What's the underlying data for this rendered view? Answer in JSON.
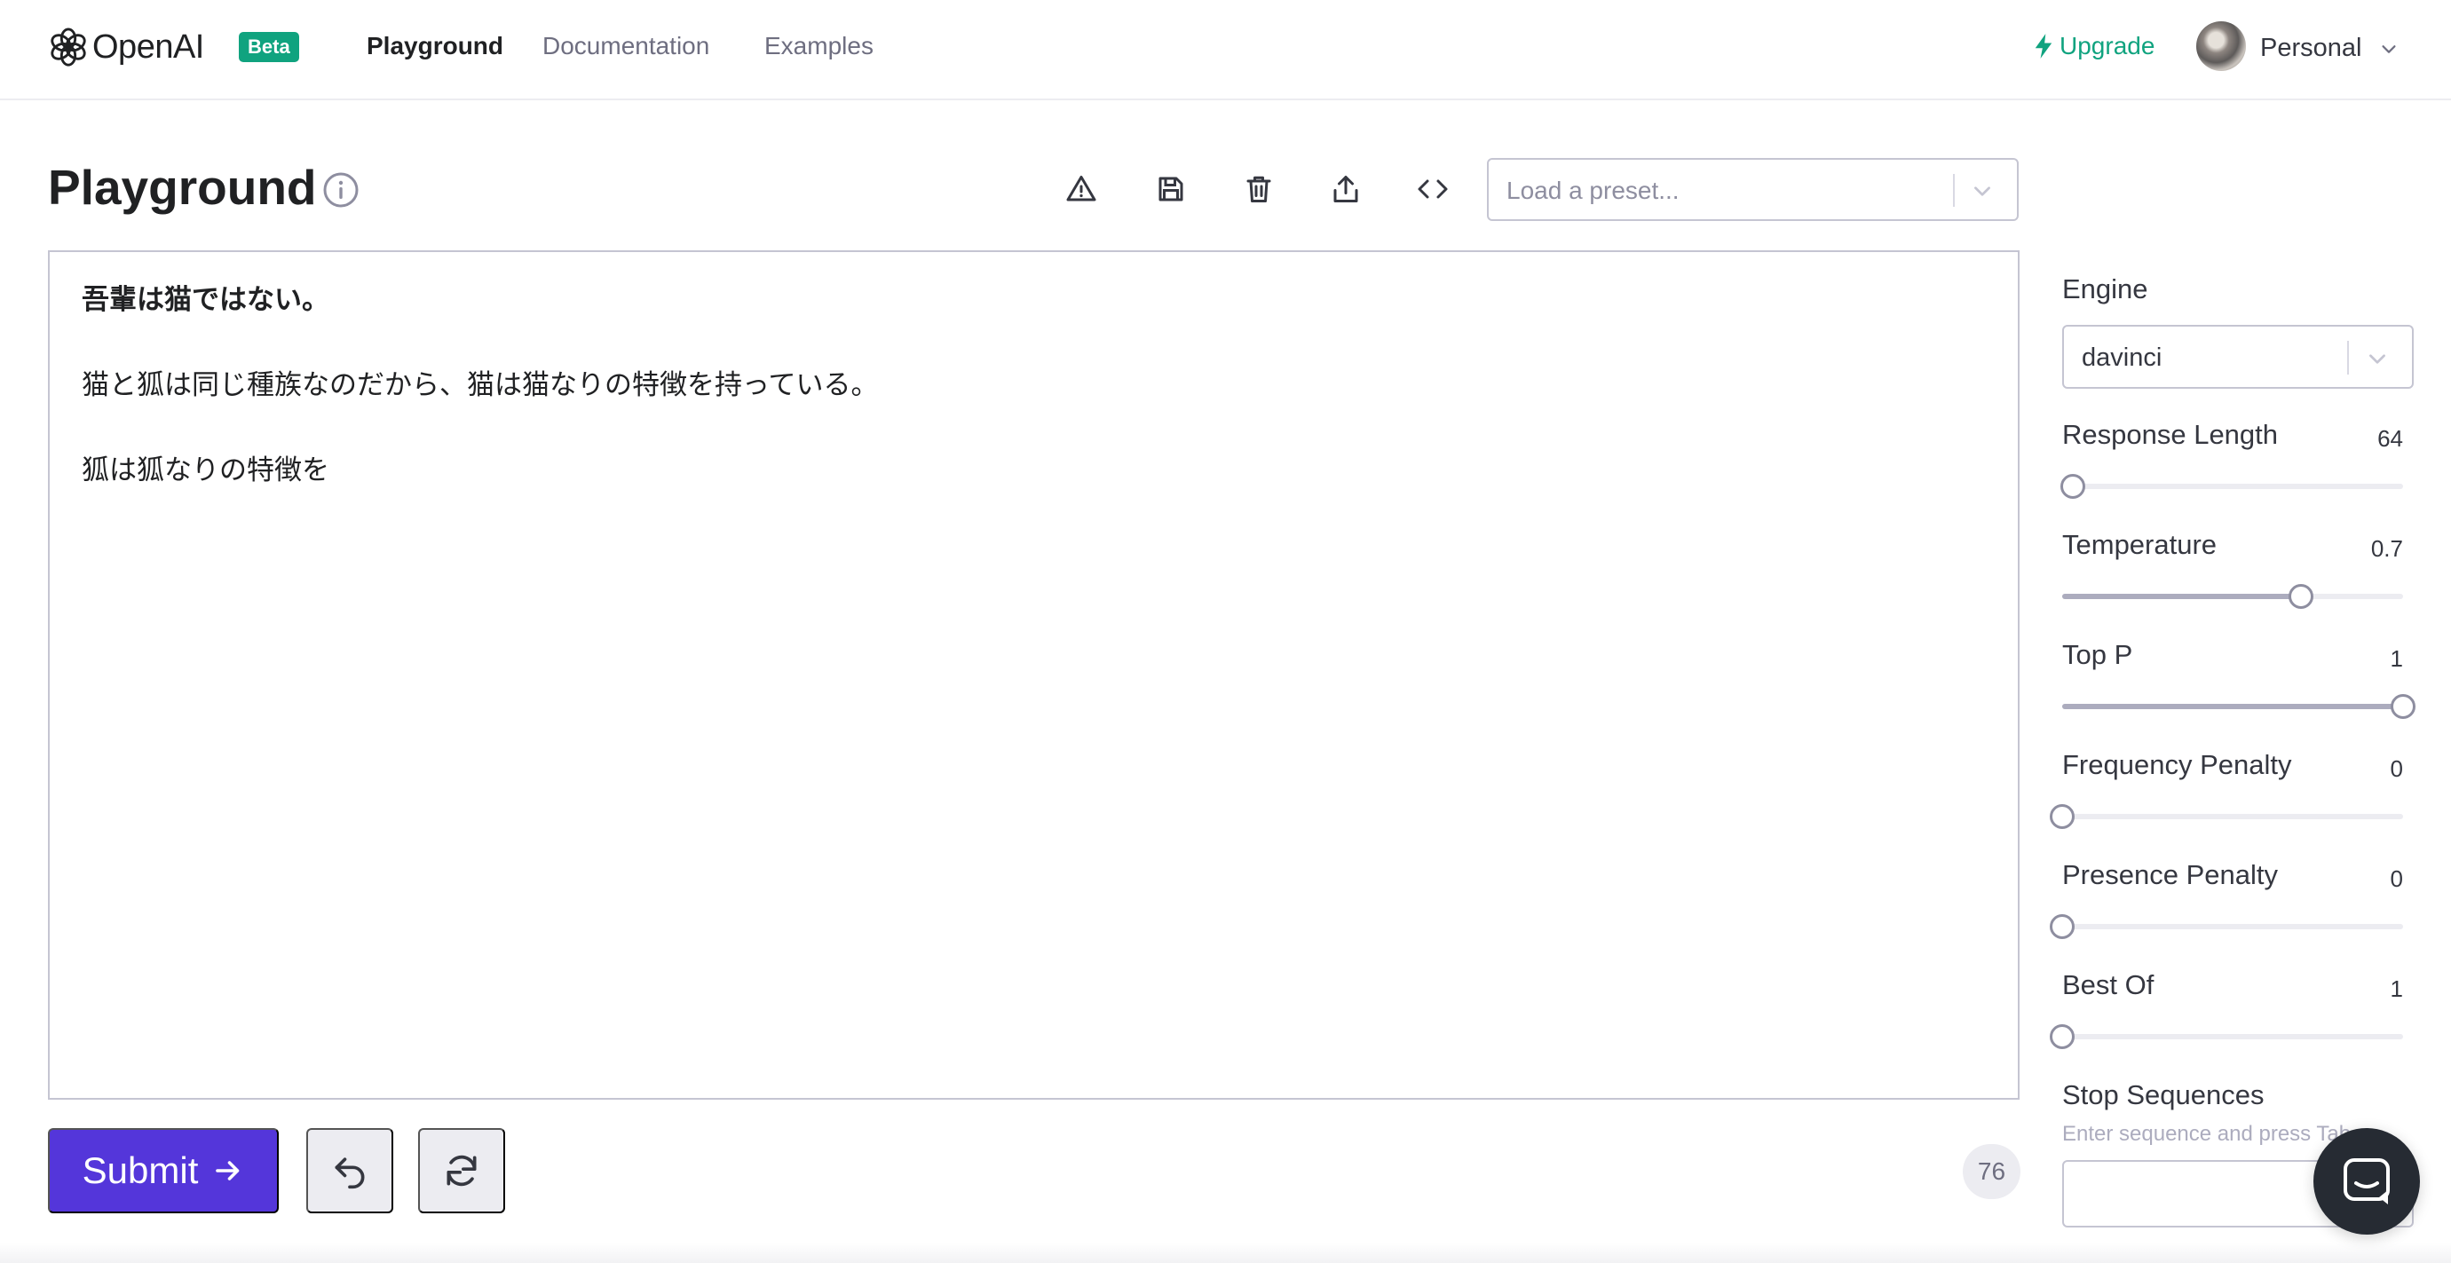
{
  "brand": {
    "name": "OpenAI",
    "badge": "Beta"
  },
  "nav": {
    "links": [
      {
        "label": "Playground",
        "active": true
      },
      {
        "label": "Documentation",
        "active": false
      },
      {
        "label": "Examples",
        "active": false
      }
    ],
    "upgrade_label": "Upgrade",
    "account_label": "Personal"
  },
  "header": {
    "title": "Playground",
    "toolbar_icons": [
      "warning-icon",
      "save-icon",
      "trash-icon",
      "share-icon",
      "code-icon"
    ],
    "preset_placeholder": "Load a preset..."
  },
  "editor": {
    "lines": [
      "吾輩は猫ではない。",
      "猫と狐は同じ種族なのだから、猫は猫なりの特徴を持っている。",
      "狐は狐なりの特徴を"
    ]
  },
  "actions": {
    "submit_label": "Submit",
    "undo_icon": "undo-icon",
    "regenerate_icon": "refresh-icon",
    "token_count": "76"
  },
  "settings": {
    "engine_label": "Engine",
    "engine_value": "davinci",
    "sliders": [
      {
        "label": "Response Length",
        "value": "64",
        "fraction": 0.03
      },
      {
        "label": "Temperature",
        "value": "0.7",
        "fraction": 0.7
      },
      {
        "label": "Top P",
        "value": "1",
        "fraction": 1.0
      },
      {
        "label": "Frequency Penalty",
        "value": "0",
        "fraction": 0.0
      },
      {
        "label": "Presence Penalty",
        "value": "0",
        "fraction": 0.0
      },
      {
        "label": "Best Of",
        "value": "1",
        "fraction": 0.0
      }
    ],
    "stop_label": "Stop Sequences",
    "stop_hint": "Enter sequence and press Tab"
  },
  "colors": {
    "accent": "#10a37f",
    "submit": "#5436da"
  }
}
